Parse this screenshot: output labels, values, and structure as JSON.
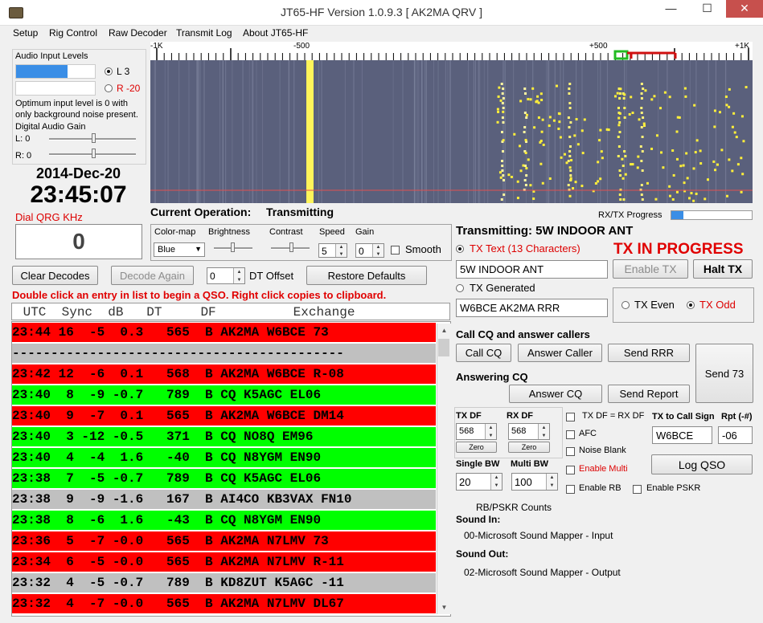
{
  "window": {
    "title": "JT65-HF Version 1.0.9.3  [ AK2MA QRV ]",
    "minimize": "—",
    "maximize": "☐",
    "close": "✕"
  },
  "menu": [
    "Setup",
    "Rig Control",
    "Raw Decoder",
    "Transmit Log",
    "About JT65-HF"
  ],
  "audio": {
    "title": "Audio Input Levels",
    "left_label": "L 3",
    "right_label": "R -20",
    "left_level": 0.65,
    "right_level": 0.0,
    "note": "Optimum input level is 0 with only background noise present.",
    "gain_title": "Digital Audio Gain",
    "gain_l": "L: 0",
    "gain_r": "R: 0"
  },
  "date": "2014-Dec-20",
  "time": "23:45:07",
  "dial_label": "Dial QRG KHz",
  "dial_value": "0",
  "scale_labels": [
    "-1K",
    "-500",
    "+500",
    "+1K"
  ],
  "current_operation_label": "Current Operation:",
  "current_operation_value": "Transmitting",
  "rxtx_progress_label": "RX/TX Progress",
  "rxtx_progress": 0.15,
  "controls": {
    "colormap_label": "Color-map",
    "colormap_value": "Blue",
    "brightness_label": "Brightness",
    "contrast_label": "Contrast",
    "speed_label": "Speed",
    "speed_value": "5",
    "gain_label": "Gain",
    "gain_value": "0",
    "smooth_label": "Smooth"
  },
  "buttons": {
    "clear_decodes": "Clear Decodes",
    "decode_again": "Decode Again",
    "dt_offset_value": "0",
    "dt_offset_label": "DT Offset",
    "restore_defaults": "Restore Defaults"
  },
  "hint": "Double click an entry in list to begin a QSO.  Right click copies to clipboard.",
  "decode_columns": " UTC  Sync  dB   DT     DF          Exchange",
  "decodes": [
    {
      "text": "23:44 16  -5  0.3   565  B AK2MA W6BCE 73",
      "bg": "#ff0000"
    },
    {
      "text": "-------------------------------------------",
      "bg": "#c0c0c0"
    },
    {
      "text": "23:42 12  -6  0.1   568  B AK2MA W6BCE R-08",
      "bg": "#ff0000"
    },
    {
      "text": "23:40  8  -9 -0.7   789  B CQ K5AGC EL06",
      "bg": "#00ff00"
    },
    {
      "text": "23:40  9  -7  0.1   565  B AK2MA W6BCE DM14",
      "bg": "#ff0000"
    },
    {
      "text": "23:40  3 -12 -0.5   371  B CQ NO8Q EM96",
      "bg": "#00ff00"
    },
    {
      "text": "23:40  4  -4  1.6   -40  B CQ N8YGM EN90",
      "bg": "#00ff00"
    },
    {
      "text": "23:38  7  -5 -0.7   789  B CQ K5AGC EL06",
      "bg": "#00ff00"
    },
    {
      "text": "23:38  9  -9 -1.6   167  B AI4CO KB3VAX FN10",
      "bg": "#c0c0c0"
    },
    {
      "text": "23:38  8  -6  1.6   -43  B CQ N8YGM EN90",
      "bg": "#00ff00"
    },
    {
      "text": "23:36  5  -7 -0.0   565  B AK2MA N7LMV 73",
      "bg": "#ff0000"
    },
    {
      "text": "23:34  6  -5 -0.0   565  B AK2MA N7LMV R-11",
      "bg": "#ff0000"
    },
    {
      "text": "23:32  4  -5 -0.7   789  B KD8ZUT K5AGC -11",
      "bg": "#c0c0c0"
    },
    {
      "text": "23:32  4  -7 -0.0   565  B AK2MA N7LMV DL67",
      "bg": "#ff0000"
    }
  ],
  "tx": {
    "transmitting_label": "Transmitting: 5W INDOOR ANT",
    "tx_text_label": "TX Text (13 Characters)",
    "tx_in_progress": "TX IN PROGRESS",
    "tx_text_value": "5W INDOOR ANT",
    "enable_tx": "Enable TX",
    "halt_tx": "Halt TX",
    "tx_generated_label": "TX Generated",
    "tx_generated_value": "W6BCE AK2MA RRR",
    "tx_even": "TX Even",
    "tx_odd": "TX Odd"
  },
  "cq": {
    "heading": "Call CQ and answer callers",
    "call_cq": "Call CQ",
    "answer_caller": "Answer Caller",
    "send_rrr": "Send RRR",
    "send_73": "Send 73",
    "answering_heading": "Answering CQ",
    "answer_cq": "Answer CQ",
    "send_report": "Send Report"
  },
  "df": {
    "tx_df_label": "TX DF",
    "tx_df_value": "568",
    "rx_df_label": "RX DF",
    "rx_df_value": "568",
    "zero": "Zero",
    "tx_eq_rx": "TX DF = RX DF",
    "afc": "AFC",
    "noise_blank": "Noise Blank",
    "enable_multi": "Enable Multi",
    "enable_rb": "Enable RB",
    "enable_pskr": "Enable PSKR",
    "to_call_label": "TX to Call Sign",
    "to_call_value": "W6BCE",
    "rpt_label": "Rpt (-#)",
    "rpt_value": "-06",
    "log_qso": "Log QSO",
    "single_bw_label": "Single BW",
    "single_bw_value": "20",
    "multi_bw_label": "Multi BW",
    "multi_bw_value": "100"
  },
  "status": {
    "rbpskr": "RB/PSKR Counts",
    "sound_in_label": "Sound In:",
    "sound_in_value": "00-Microsoft Sound Mapper - Input",
    "sound_out_label": "Sound Out:",
    "sound_out_value": "02-Microsoft Sound Mapper - Output"
  }
}
